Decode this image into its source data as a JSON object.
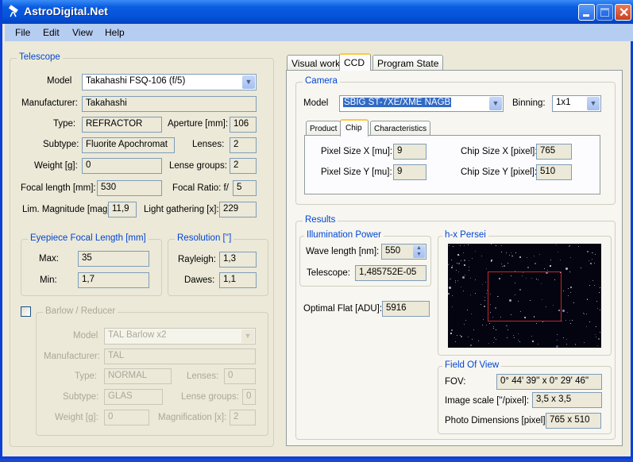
{
  "window": {
    "title": "AstroDigital.Net",
    "icon": "telescope-icon",
    "buttons": [
      "minimize",
      "maximize",
      "close"
    ]
  },
  "menu": [
    "File",
    "Edit",
    "View",
    "Help"
  ],
  "telescope": {
    "legend": "Telescope",
    "model_label": "Model",
    "model": "Takahashi FSQ-106 (f/5)",
    "manufacturer_label": "Manufacturer:",
    "manufacturer": "Takahashi",
    "type_label": "Type:",
    "type": "REFRACTOR",
    "aperture_label": "Aperture [mm]:",
    "aperture": "106",
    "subtype_label": "Subtype:",
    "subtype": "Fluorite Apochromat",
    "lenses_label": "Lenses:",
    "lenses": "2",
    "weight_label": "Weight [g]:",
    "weight": "0",
    "lense_groups_label": "Lense groups:",
    "lense_groups": "2",
    "focal_length_label": "Focal length [mm]:",
    "focal_length": "530",
    "focal_ratio_label": "Focal Ratio:  f/",
    "focal_ratio": "5",
    "lim_mag_label": "Lim. Magnitude [mag]:",
    "lim_mag": "11,9",
    "light_gathering_label": "Light gathering [x]:",
    "light_gathering": "229"
  },
  "eyepiece": {
    "legend": "Eyepiece Focal Length [mm]",
    "max_label": "Max:",
    "max": "35",
    "min_label": "Min:",
    "min": "1,7"
  },
  "resolution": {
    "legend": "Resolution ['']",
    "rayleigh_label": "Rayleigh:",
    "rayleigh": "1,3",
    "dawes_label": "Dawes:",
    "dawes": "1,1"
  },
  "barlow": {
    "legend": "Barlow / Reducer",
    "enabled": false,
    "model_label": "Model",
    "model": "TAL Barlow x2",
    "manufacturer_label": "Manufacturer:",
    "manufacturer": "TAL",
    "type_label": "Type:",
    "type": "NORMAL",
    "lenses_label": "Lenses:",
    "lenses": "0",
    "subtype_label": "Subtype:",
    "subtype": "GLAS",
    "lense_groups_label": "Lense groups:",
    "lense_groups": "0",
    "weight_label": "Weight [g]:",
    "weight": "0",
    "magnification_label": "Magnification [x]:",
    "magnification": "2"
  },
  "tabs": [
    {
      "label": "Visual work"
    },
    {
      "label": "CCD",
      "active": true
    },
    {
      "label": "Program State"
    }
  ],
  "camera": {
    "legend": "Camera",
    "model_label": "Model",
    "model": "SBIG ST-7XE/XME NAGB",
    "binning_label": "Binning:",
    "binning": "1x1",
    "subtabs": [
      {
        "label": "Product"
      },
      {
        "label": "Chip",
        "active": true
      },
      {
        "label": "Characteristics"
      }
    ],
    "pixel_x_label": "Pixel Size X [mu]:",
    "pixel_x": "9",
    "pixel_y_label": "Pixel Size Y [mu]:",
    "pixel_y": "9",
    "chip_x_label": "Chip Size X [pixel]:",
    "chip_x": "765",
    "chip_y_label": "Chip Size Y [pixel]:",
    "chip_y": "510"
  },
  "results": {
    "legend": "Results",
    "illumination_legend": "Illumination Power",
    "wavelength_label": "Wave length [nm]:",
    "wavelength": "550",
    "telescope_label": "Telescope:",
    "telescope": "1,485752E-05",
    "optimal_flat_label": "Optimal Flat [ADU]:",
    "optimal_flat": "5916",
    "preview_legend": "h-x Persei",
    "fov_legend": "Field Of View",
    "fov_label": "FOV:",
    "fov": "0° 44' 39''  x 0° 29' 46''",
    "image_scale_label": "Image scale [''/pixel]:",
    "image_scale": "3,5 x 3,5",
    "photo_dim_label": "Photo Dimensions [pixel]:",
    "photo_dim": "765 x 510"
  },
  "colors": {
    "legend": "#0046d5",
    "selection": "#316ac5",
    "roi": "#c0282a"
  }
}
